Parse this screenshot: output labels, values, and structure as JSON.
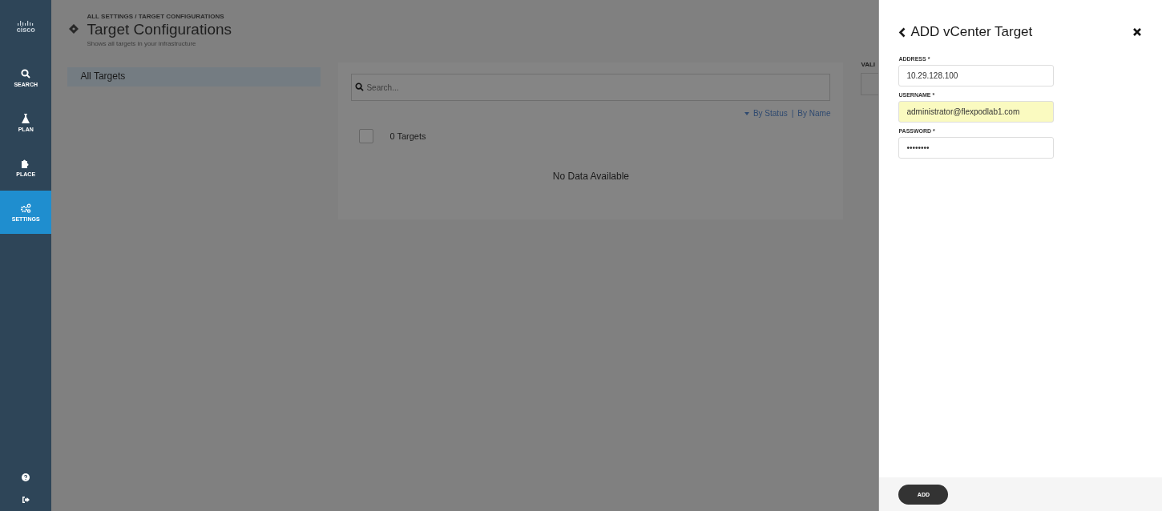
{
  "logo": {
    "text": "cisco"
  },
  "nav": [
    {
      "label": "SEARCH",
      "selected": false
    },
    {
      "label": "PLAN",
      "selected": false
    },
    {
      "label": "PLACE",
      "selected": false
    },
    {
      "label": "SETTINGS",
      "selected": true
    }
  ],
  "header": {
    "breadcrumb": "ALL SETTINGS / TARGET CONFIGURATIONS",
    "title": "Target Configurations",
    "subtitle": "Shows all targets in your infrastructure"
  },
  "sidebar": {
    "items": [
      {
        "label": "All Targets",
        "selected": true
      }
    ]
  },
  "list": {
    "search": {
      "placeholder": "Search..."
    },
    "sort": {
      "by_status": "By Status",
      "separator": "|",
      "by_name": "By Name"
    },
    "select_all": {
      "checked": false,
      "label": "0 Targets"
    },
    "empty": "No Data Available"
  },
  "column_3": {
    "label": "VALI"
  },
  "panel": {
    "title": "ADD vCenter Target",
    "fields": [
      {
        "label": "ADDRESS *",
        "value": "10.29.128.100",
        "autofilled": false
      },
      {
        "label": "USERNAME *",
        "value": "administrator@flexpodlab1.com",
        "autofilled": true
      },
      {
        "label": "PASSWORD *",
        "value": "••••••••",
        "autofilled": false
      }
    ],
    "submit": "ADD"
  }
}
